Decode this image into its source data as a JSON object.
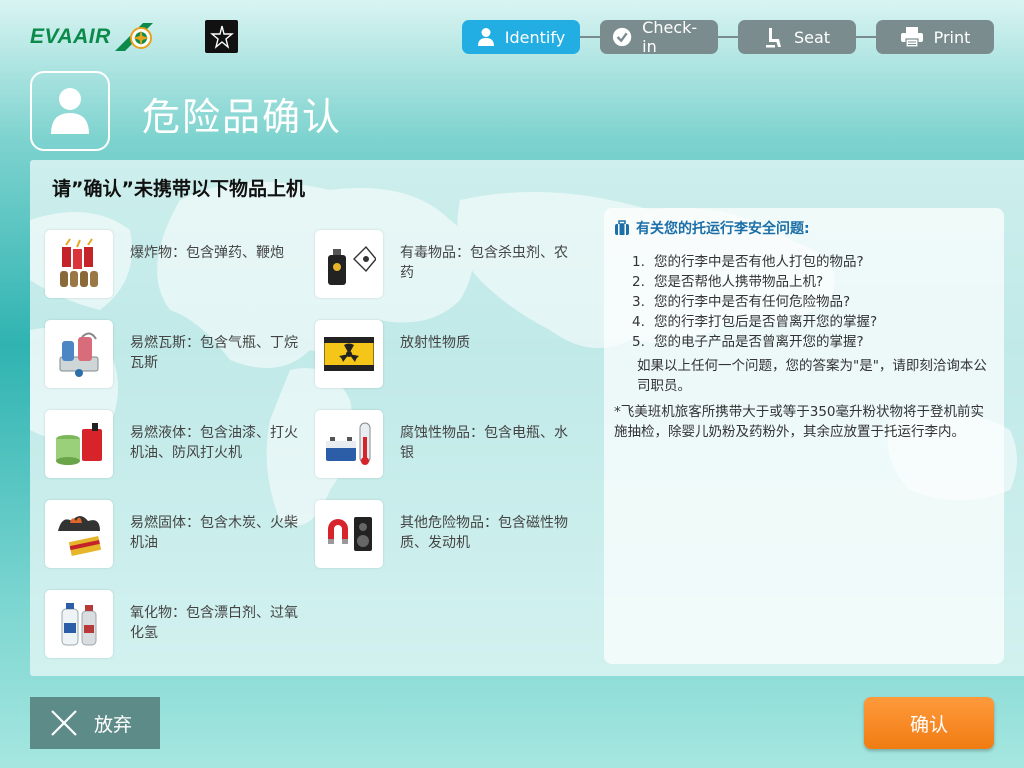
{
  "header": {
    "logo_text": "EVAAIR",
    "steps": [
      {
        "label": "Identify",
        "icon": "person-icon",
        "active": true
      },
      {
        "label": "Check-in",
        "icon": "check-circle-icon",
        "active": false
      },
      {
        "label": "Seat",
        "icon": "seat-icon",
        "active": false
      },
      {
        "label": "Print",
        "icon": "printer-icon",
        "active": false
      }
    ]
  },
  "page_title": "危险品确认",
  "panel": {
    "heading": "请”确认”未携带以下物品上机",
    "hazards": [
      {
        "label": "爆炸物：包含弹药、鞭炮",
        "icon": "firecracker-icon"
      },
      {
        "label": "有毒物品：包含杀虫剂、农药",
        "icon": "poison-icon"
      },
      {
        "label": "易燃瓦斯：包含气瓶、丁烷瓦斯",
        "icon": "gas-canister-icon"
      },
      {
        "label": "放射性物质",
        "icon": "radioactive-icon"
      },
      {
        "label": "易燃液体：包含油漆、打火机油、防风打火机",
        "icon": "flammable-liquid-icon"
      },
      {
        "label": "腐蚀性物品：包含电瓶、水银",
        "icon": "battery-thermometer-icon"
      },
      {
        "label": "易燃固体：包含木炭、火柴机油",
        "icon": "charcoal-matches-icon"
      },
      {
        "label": "其他危险物品：包含磁性物质、发动机",
        "icon": "magnet-icon"
      },
      {
        "label": "氧化物：包含漂白剂、过氧化氢",
        "icon": "bleach-icon"
      }
    ]
  },
  "info": {
    "title": "有关您的托运行李安全问题:",
    "questions": [
      "您的行李中是否有他人打包的物品?",
      "您是否帮他人携带物品上机?",
      "您的行李中是否有任何危险物品?",
      "您的行李打包后是否曾离开您的掌握?",
      "您的电子产品是否曾离开您的掌握?"
    ],
    "note": "如果以上任何一个问题，您的答案为\"是\"，请即刻洽询本公司职员。",
    "footnote": "*飞美班机旅客所携带大于或等于350毫升粉状物将于登机前实施抽检，除婴儿奶粉及药粉外，其余应放置于托运行李内。"
  },
  "buttons": {
    "cancel_label": "放弃",
    "confirm_label": "确认"
  }
}
